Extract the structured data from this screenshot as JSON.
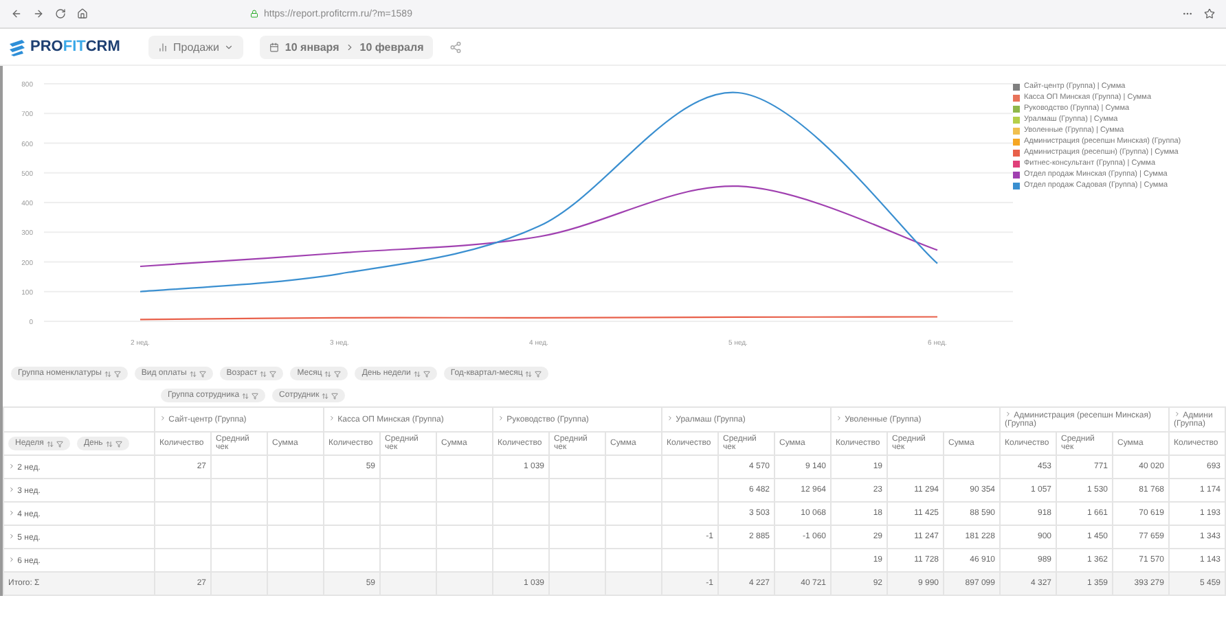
{
  "browser": {
    "url": "https://report.profitcrm.ru/?m=1589"
  },
  "header": {
    "logo_parts": [
      "PRO",
      "FIT",
      "CRM"
    ],
    "report_select": "Продажи",
    "date_from": "10 января",
    "date_to": "10 февраля"
  },
  "chart": {
    "chart_data": {
      "type": "line",
      "categories": [
        "2 нед.",
        "3 нед.",
        "4 нед.",
        "5 нед.",
        "6 нед."
      ],
      "ylim": [
        0,
        800
      ],
      "grid": true,
      "yticks": [
        0,
        100,
        200,
        300,
        400,
        500,
        600,
        700,
        800
      ],
      "series": [
        {
          "name": "Сайт-центр (Группа) | Сумма",
          "color": "#808080",
          "values": [
            null,
            null,
            null,
            null,
            null
          ]
        },
        {
          "name": "Касса ОП Минская (Группа) | Сумма",
          "color": "#e8735a",
          "values": [
            null,
            null,
            null,
            null,
            null
          ]
        },
        {
          "name": "Руководство (Группа) | Сумма",
          "color": "#8fb74a",
          "values": [
            null,
            null,
            null,
            null,
            null
          ]
        },
        {
          "name": "Уралмаш (Группа) | Сумма",
          "color": "#b5cf4a",
          "values": [
            null,
            null,
            null,
            null,
            null
          ]
        },
        {
          "name": "Уволенные (Группа) | Сумма",
          "color": "#f0c050",
          "values": [
            null,
            null,
            null,
            null,
            null
          ]
        },
        {
          "name": "Администрация (ресепшн Минская) (Группа)",
          "color": "#f5a623",
          "values": [
            null,
            null,
            null,
            null,
            null
          ]
        },
        {
          "name": "Администрация (ресепшн) (Группа) | Сумма",
          "color": "#e8604a",
          "values": [
            6,
            12,
            12,
            14,
            15
          ]
        },
        {
          "name": "Фитнес-консультант (Группа) | Сумма",
          "color": "#e0407a",
          "values": [
            null,
            null,
            null,
            null,
            null
          ]
        },
        {
          "name": "Отдел продаж Минская (Группа) | Сумма",
          "color": "#a040b0",
          "values": [
            185,
            230,
            285,
            455,
            240
          ]
        },
        {
          "name": "Отдел продаж Садовая (Группа) | Сумма",
          "color": "#3a8fd0",
          "values": [
            100,
            160,
            320,
            770,
            195
          ]
        }
      ]
    }
  },
  "filters": {
    "row1": [
      "Группа номенклатуры",
      "Вид оплаты",
      "Возраст",
      "Месяц",
      "День недели",
      "Год-квартал-месяц"
    ],
    "row2": [
      "Группа сотрудника",
      "Сотрудник"
    ]
  },
  "table": {
    "row_fields": [
      "Неделя",
      "День"
    ],
    "groups": [
      {
        "title": "Сайт-центр (Группа)",
        "columns": [
          "Количество",
          "Средний чек",
          "Сумма"
        ]
      },
      {
        "title": "Касса ОП Минская (Группа)",
        "columns": [
          "Количество",
          "Средний чек",
          "Сумма"
        ]
      },
      {
        "title": "Руководство (Группа)",
        "columns": [
          "Количество",
          "Средний чек",
          "Сумма"
        ]
      },
      {
        "title": "Уралмаш (Группа)",
        "columns": [
          "Количество",
          "Средний чек",
          "Сумма"
        ]
      },
      {
        "title": "Уволенные (Группа)",
        "columns": [
          "Количество",
          "Средний чек",
          "Сумма"
        ]
      },
      {
        "title": "Администрация (ресепшн Минская) (Группа)",
        "columns": [
          "Количество",
          "Средний чек",
          "Сумма"
        ]
      },
      {
        "title": "Админи (Группа)",
        "columns": [
          "Количество"
        ]
      }
    ],
    "rows": [
      {
        "label": "2 нед.",
        "cells": [
          "27",
          null,
          null,
          "59",
          null,
          null,
          "1 039",
          null,
          null,
          null,
          "4 570",
          "9 140",
          "19",
          null,
          null,
          "453",
          "771",
          "40 020",
          "693"
        ]
      },
      {
        "label": "3 нед.",
        "cells": [
          null,
          null,
          null,
          null,
          null,
          null,
          null,
          null,
          null,
          null,
          "6 482",
          "12 964",
          "23",
          "11 294",
          "90 354",
          "1 057",
          "1 530",
          "81 768",
          "1 174"
        ]
      },
      {
        "label": "4 нед.",
        "cells": [
          null,
          null,
          null,
          null,
          null,
          null,
          null,
          null,
          null,
          null,
          "3 503",
          "10 068",
          "18",
          "11 425",
          "88 590",
          "918",
          "1 661",
          "70 619",
          "1 193"
        ]
      },
      {
        "label": "5 нед.",
        "cells": [
          null,
          null,
          null,
          null,
          null,
          null,
          null,
          null,
          null,
          "-1",
          "2 885",
          "-1 060",
          "29",
          "11 247",
          "181 228",
          "900",
          "1 450",
          "77 659",
          "1 343"
        ]
      },
      {
        "label": "6 нед.",
        "cells": [
          null,
          null,
          null,
          null,
          null,
          null,
          null,
          null,
          null,
          null,
          null,
          null,
          "19",
          "11 728",
          "46 910",
          "989",
          "1 362",
          "71 570",
          "1 143"
        ]
      }
    ],
    "total": {
      "label": "Итого: Σ",
      "cells": [
        "27",
        null,
        null,
        "59",
        null,
        null,
        "1 039",
        null,
        null,
        "-1",
        "4 227",
        "40 721",
        "92",
        "9 990",
        "897 099",
        "4 327",
        "1 359",
        "393 279",
        "5 459"
      ]
    }
  }
}
